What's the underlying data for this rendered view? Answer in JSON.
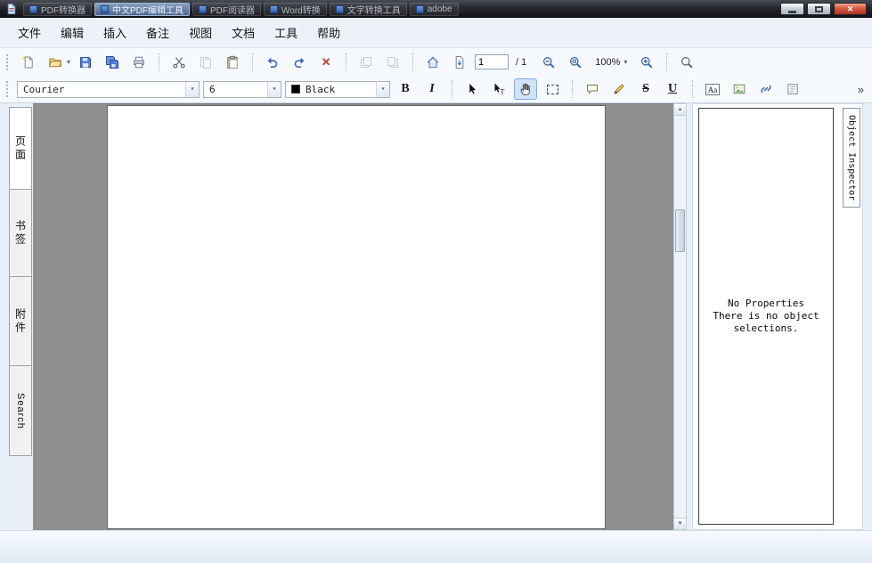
{
  "titlebar": {
    "tabs": [
      {
        "label": "PDF转换器"
      },
      {
        "label": "中文PDF编辑工具"
      },
      {
        "label": "PDF阅读器"
      },
      {
        "label": "Word转换"
      },
      {
        "label": "文字转换工具"
      },
      {
        "label": "adobe"
      }
    ]
  },
  "glyphs": {
    "close": "✕",
    "caret": "▾",
    "delete": "✕",
    "overflow": "»",
    "scroll_up": "▲",
    "scroll_down": "▼"
  },
  "menubar": {
    "items": [
      "文件",
      "编辑",
      "插入",
      "备注",
      "视图",
      "文档",
      "工具",
      "帮助"
    ]
  },
  "toolbar_main": {
    "page_current": "1",
    "page_total": "/ 1",
    "zoom_value": "100%"
  },
  "toolbar_format": {
    "font_value": "Courier",
    "size_value": "6",
    "color_value": "Black",
    "bold": "B",
    "italic": "I",
    "strike": "S",
    "underline": "U",
    "text_edit": "Aa"
  },
  "sidebar": {
    "tabs": [
      {
        "label": "页面"
      },
      {
        "label": "书签"
      },
      {
        "label": "附件"
      },
      {
        "label": "Search"
      }
    ]
  },
  "inspector": {
    "tab_label": "Object Inspector",
    "lines": [
      "No Properties",
      "There is no object",
      "selections."
    ]
  },
  "colors": {
    "tool_selection": "#cfe3fa",
    "close_button": "#c4452e",
    "canvas_gray": "#8f8f8f",
    "titlebar_dark": "#15171c"
  }
}
